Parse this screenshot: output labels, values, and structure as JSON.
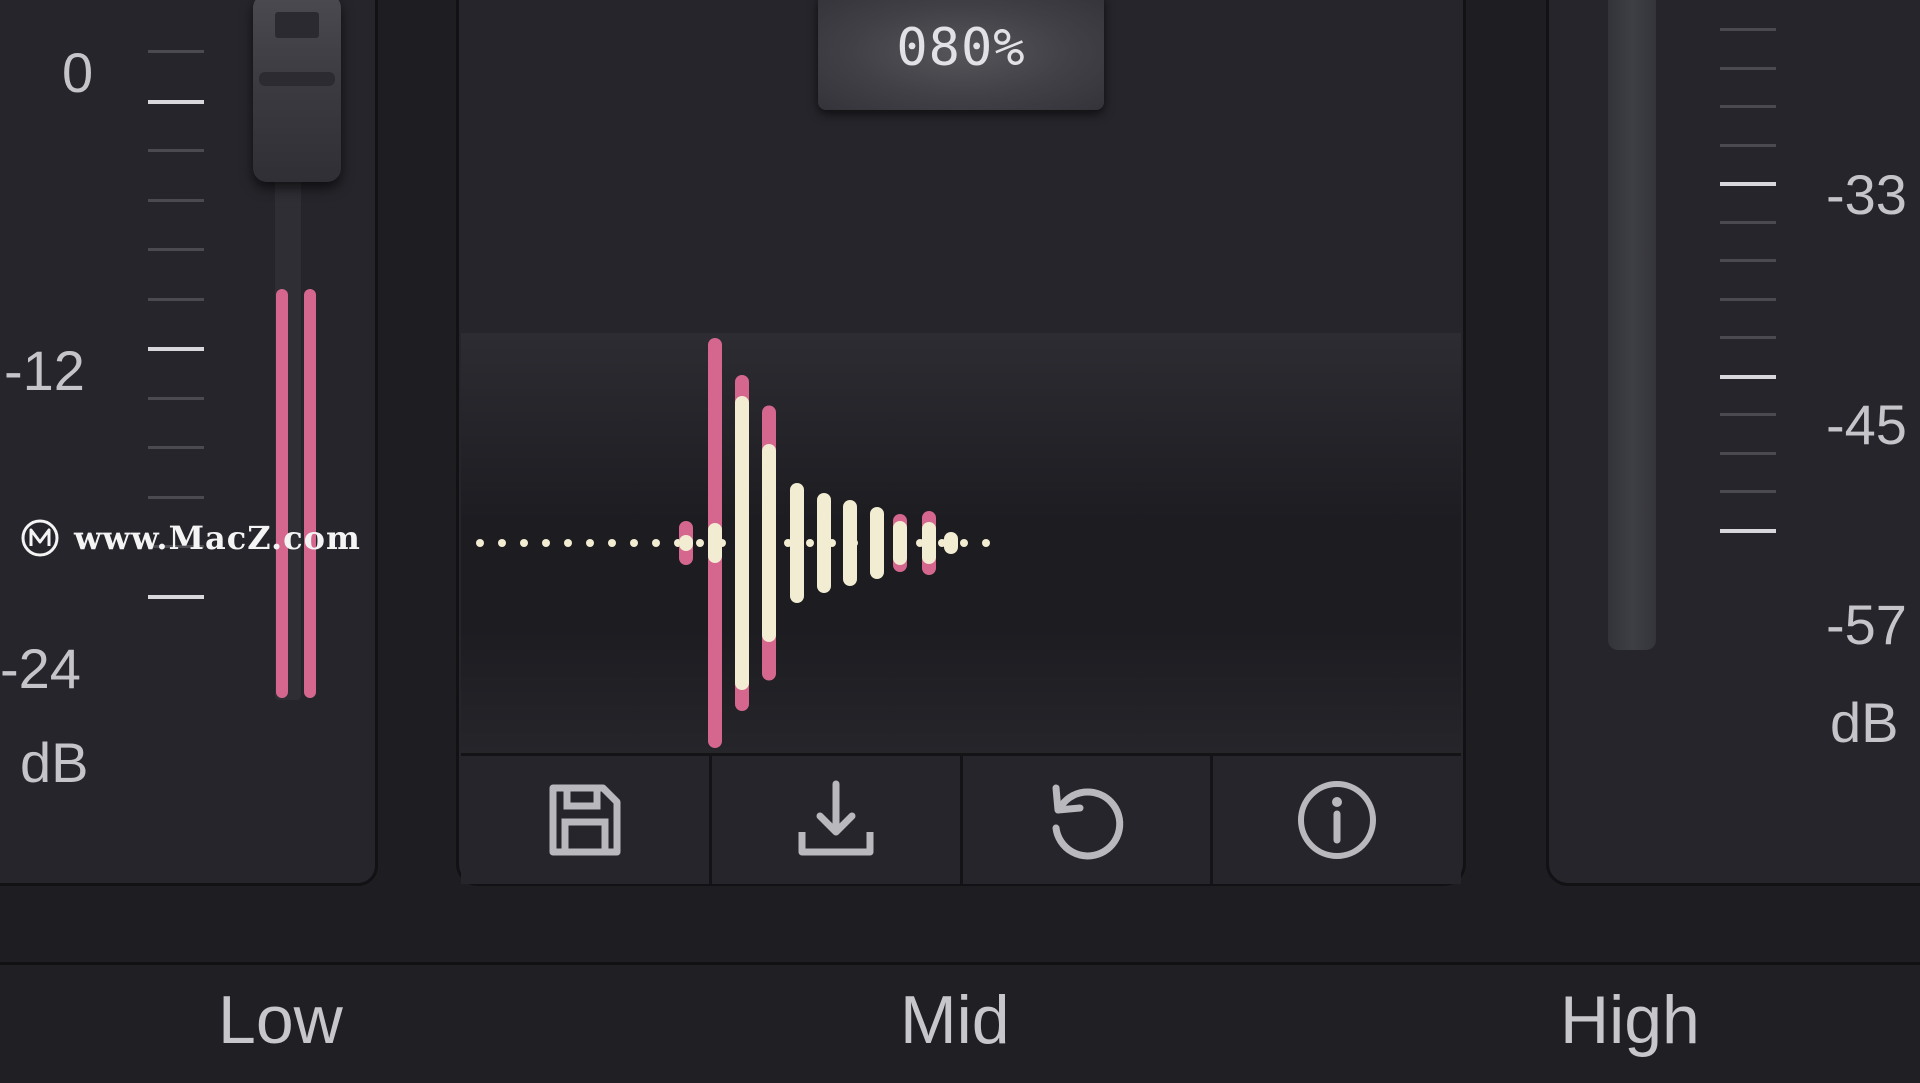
{
  "low": {
    "scale_labels": [
      "0",
      "-12",
      "-24"
    ],
    "unit": "dB",
    "meter_level": 0.73
  },
  "mid": {
    "percent": "080%"
  },
  "high": {
    "scale_labels": [
      "-33",
      "-45",
      "-57"
    ],
    "unit": "dB"
  },
  "toolbar": {
    "buttons": [
      {
        "icon": "save-icon"
      },
      {
        "icon": "download-icon"
      },
      {
        "icon": "reset-icon"
      },
      {
        "icon": "info-icon"
      }
    ]
  },
  "bands": {
    "low": "Low",
    "mid": "Mid",
    "high": "High"
  },
  "watermark": {
    "text": "www.MacZ.com"
  },
  "colors": {
    "accent_pink": "#d5678e",
    "wave_cream": "#f1ecd2",
    "background": "#1d1d22"
  }
}
